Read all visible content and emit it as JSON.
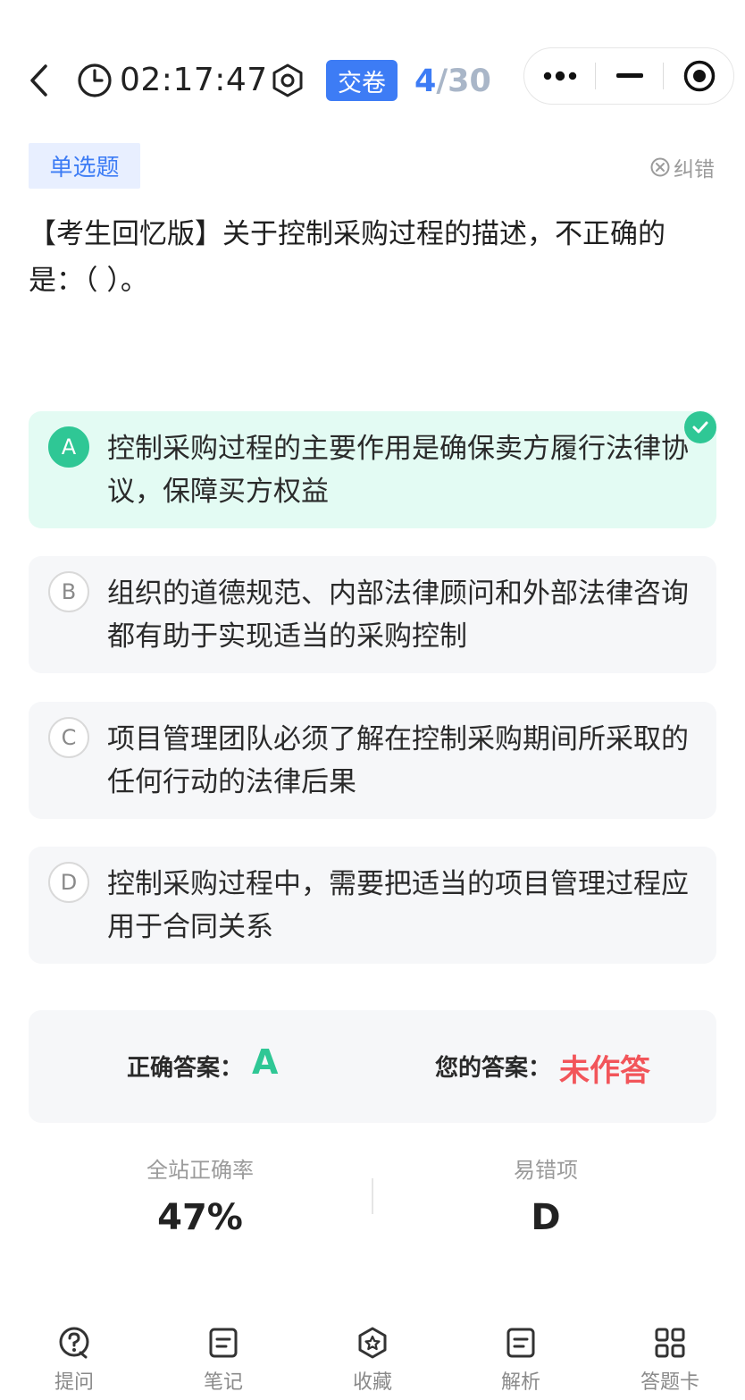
{
  "header": {
    "timer": "02:17:47",
    "submit_label": "交卷",
    "progress_current": "4",
    "progress_total": "/30"
  },
  "question": {
    "type_tag": "单选题",
    "report_label": "纠错",
    "text": "【考生回忆版】关于控制采购过程的描述，不正确的是：（ ）。",
    "options": [
      {
        "letter": "A",
        "text": "控制采购过程的主要作用是确保卖方履行法律协议，保障买方权益",
        "selected": true
      },
      {
        "letter": "B",
        "text": "组织的道德规范、内部法律顾问和外部法律咨询都有助于实现适当的采购控制",
        "selected": false
      },
      {
        "letter": "C",
        "text": "项目管理团队必须了解在控制采购期间所采取的任何行动的法律后果",
        "selected": false
      },
      {
        "letter": "D",
        "text": "控制采购过程中，需要把适当的项目管理过程应用于合同关系",
        "selected": false
      }
    ]
  },
  "answer": {
    "correct_label": "正确答案：",
    "correct_value": "A",
    "yours_label": "您的答案：",
    "yours_value": "未作答"
  },
  "stats": {
    "accuracy_label": "全站正确率",
    "accuracy_value": "47%",
    "common_wrong_label": "易错项",
    "common_wrong_value": "D"
  },
  "nav": [
    {
      "label": "提问",
      "icon": "question-icon"
    },
    {
      "label": "笔记",
      "icon": "note-icon"
    },
    {
      "label": "收藏",
      "icon": "favorite-icon"
    },
    {
      "label": "解析",
      "icon": "analysis-icon"
    },
    {
      "label": "答题卡",
      "icon": "answer-card-icon"
    }
  ],
  "colors": {
    "primary": "#3d7cf5",
    "correct": "#2fc795",
    "wrong": "#f2555a",
    "selected_bg": "#e3fbf3"
  }
}
